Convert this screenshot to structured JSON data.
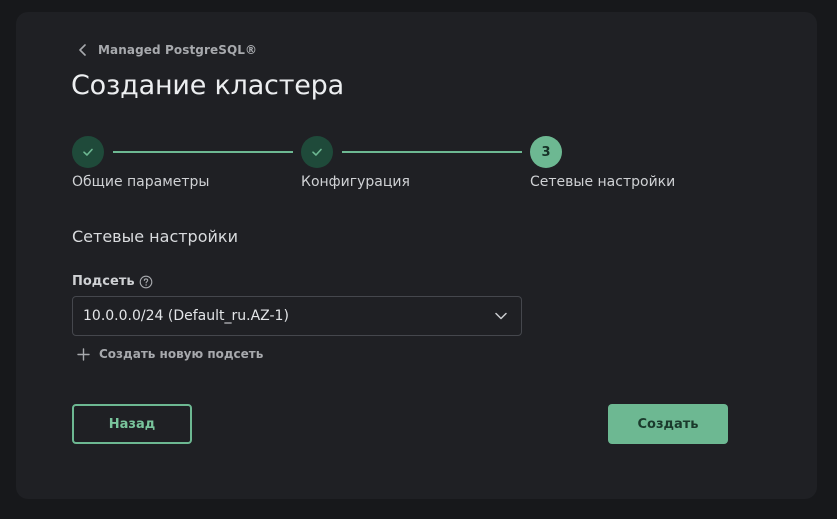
{
  "breadcrumb": {
    "label": "Managed PostgreSQL®"
  },
  "page": {
    "title": "Создание кластера"
  },
  "steps": [
    {
      "label": "Общие параметры",
      "status": "done"
    },
    {
      "label": "Конфигурация",
      "status": "done"
    },
    {
      "label": "Сетевые настройки",
      "status": "current",
      "number": "3"
    }
  ],
  "section": {
    "title": "Сетевые настройки"
  },
  "subnet": {
    "label": "Подсеть",
    "value": "10.0.0.0/24 (Default_ru.AZ-1)"
  },
  "add_subnet": {
    "label": "Создать новую подсеть"
  },
  "actions": {
    "back_label": "Назад",
    "create_label": "Создать"
  },
  "colors": {
    "accent": "#6db892",
    "accent_dark": "#1f4a3a",
    "card_bg": "#1f2024",
    "page_bg": "#17181b"
  },
  "icons": {
    "back": "chevron-left-icon",
    "done_step": "check-icon",
    "help": "question-circle-icon",
    "select": "chevron-down-icon",
    "add": "plus-icon"
  }
}
